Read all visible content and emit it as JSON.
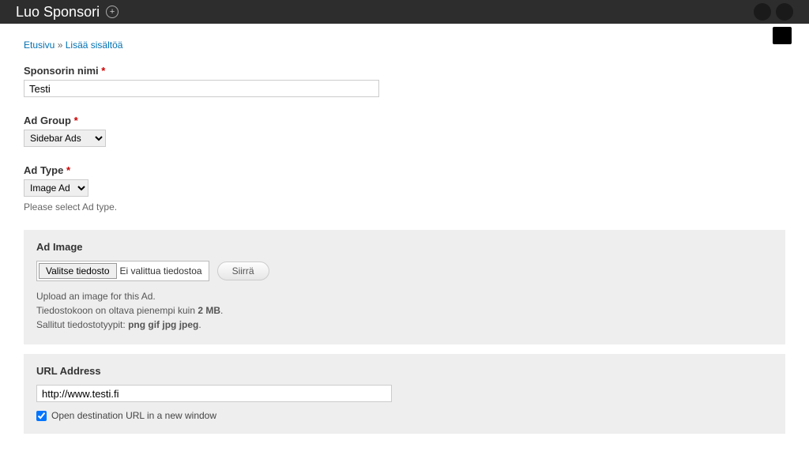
{
  "header": {
    "title": "Luo Sponsori"
  },
  "breadcrumb": {
    "home": "Etusivu",
    "separator": "»",
    "current": "Lisää sisältöä"
  },
  "sponsor_name": {
    "label": "Sponsorin nimi",
    "value": "Testi"
  },
  "ad_group": {
    "label": "Ad Group",
    "selected": "Sidebar Ads"
  },
  "ad_type": {
    "label": "Ad Type",
    "selected": "Image Ad",
    "help": "Please select Ad type."
  },
  "ad_image": {
    "legend": "Ad Image",
    "choose_btn": "Valitse tiedosto",
    "no_file": "Ei valittua tiedostoa",
    "upload_btn": "Siirrä",
    "help_line1": "Upload an image for this Ad.",
    "help_line2_a": "Tiedostokoon on oltava pienempi kuin ",
    "help_line2_b": "2 MB",
    "help_line2_c": ".",
    "help_line3_a": "Sallitut tiedostotyypit: ",
    "help_line3_b": "png gif jpg jpeg",
    "help_line3_c": "."
  },
  "url_address": {
    "legend": "URL Address",
    "value": "http://www.testi.fi",
    "checkbox_label": "Open destination URL in a new window",
    "checked": true
  }
}
